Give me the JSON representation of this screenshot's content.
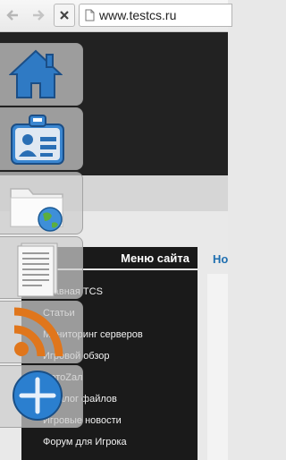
{
  "browser": {
    "url": "www.testcs.ru",
    "icons": [
      "back-arrow-icon",
      "forward-arrow-icon",
      "close-icon",
      "page-icon"
    ]
  },
  "sidebar": {
    "title": "Меню сайта",
    "items": [
      {
        "label": "Главная TCS"
      },
      {
        "label": "Статьи"
      },
      {
        "label": "Мониторинг серверов"
      },
      {
        "label": "Игровой обзор"
      },
      {
        "label": "ФотоZал"
      },
      {
        "label": "Каталог файлов"
      },
      {
        "label": "Игровые новости"
      },
      {
        "label": "Форум для Игрока"
      }
    ]
  },
  "content": {
    "title_fragment": "Но"
  },
  "dock": {
    "icons": [
      "home-icon",
      "contact-card-icon",
      "folder-globe-icon",
      "document-icon",
      "rss-icon",
      "add-icon"
    ]
  },
  "colors": {
    "header": "#222222",
    "menu_bg": "#1a1a1a",
    "link_blue": "#1f6fb0",
    "home_blue": "#2f7ac4"
  }
}
